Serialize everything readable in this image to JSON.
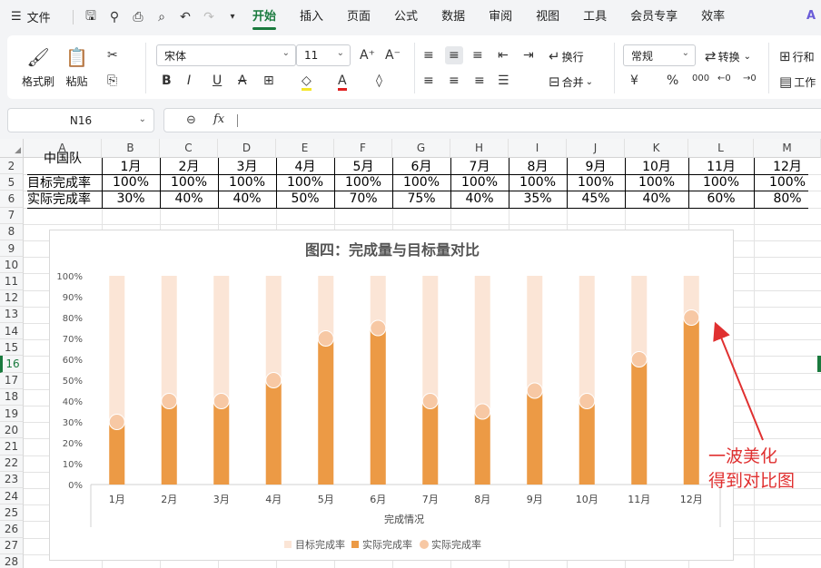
{
  "menubar": {
    "file_label": "文件",
    "tabs": [
      "开始",
      "插入",
      "页面",
      "公式",
      "数据",
      "审阅",
      "视图",
      "工具",
      "会员专享",
      "效率"
    ],
    "active_tab": "开始"
  },
  "ribbon": {
    "format_painter": "格式刷",
    "paste": "粘贴",
    "font_name": "宋体",
    "font_size": "11",
    "wrap": "换行",
    "merge": "合并",
    "number_format": "常规",
    "convert": "转换",
    "row_col": "行和",
    "worksheet": "工作"
  },
  "formula_bar": {
    "cell_ref": "N16",
    "fx_label": "fx",
    "formula": ""
  },
  "grid": {
    "columns": [
      "A",
      "B",
      "C",
      "D",
      "E",
      "F",
      "G",
      "H",
      "I",
      "J",
      "K",
      "L",
      "M"
    ],
    "rows": [
      "2",
      "5",
      "6",
      "7",
      "8",
      "9",
      "10",
      "11",
      "12",
      "13",
      "14",
      "15",
      "16",
      "17",
      "18",
      "19",
      "20",
      "21",
      "22",
      "23",
      "24",
      "25",
      "26",
      "27",
      "28"
    ],
    "selected_row": "16",
    "partial_header": "中国队",
    "header_row": [
      "1月",
      "2月",
      "3月",
      "4月",
      "5月",
      "6月",
      "7月",
      "8月",
      "9月",
      "10月",
      "11月",
      "12月"
    ],
    "target_label": "目标完成率",
    "target_row": [
      "100%",
      "100%",
      "100%",
      "100%",
      "100%",
      "100%",
      "100%",
      "100%",
      "100%",
      "100%",
      "100%",
      "100%"
    ],
    "actual_label": "实际完成率",
    "actual_row": [
      "30%",
      "40%",
      "40%",
      "50%",
      "70%",
      "75%",
      "40%",
      "35%",
      "45%",
      "40%",
      "60%",
      "80%"
    ]
  },
  "chart_data": {
    "type": "bar",
    "title": "图四：完成量与目标量对比",
    "xlabel": "完成情况",
    "ylabel": "",
    "categories": [
      "1月",
      "2月",
      "3月",
      "4月",
      "5月",
      "6月",
      "7月",
      "8月",
      "9月",
      "10月",
      "11月",
      "12月"
    ],
    "series": [
      {
        "name": "目标完成率",
        "values": [
          100,
          100,
          100,
          100,
          100,
          100,
          100,
          100,
          100,
          100,
          100,
          100
        ],
        "color": "#fbe5d6"
      },
      {
        "name": "实际完成率",
        "values": [
          30,
          40,
          40,
          50,
          70,
          75,
          40,
          35,
          45,
          40,
          60,
          80
        ],
        "color": "#ec9a45"
      },
      {
        "name": "实际完成率",
        "values": [
          30,
          40,
          40,
          50,
          70,
          75,
          40,
          35,
          45,
          40,
          60,
          80
        ],
        "color": "#f7c8a4",
        "marker": "circle"
      }
    ],
    "y_ticks": [
      "0%",
      "10%",
      "20%",
      "30%",
      "40%",
      "50%",
      "60%",
      "70%",
      "80%",
      "90%",
      "100%"
    ],
    "ylim": [
      0,
      100
    ],
    "grid": false,
    "legend": "bottom"
  },
  "annotation": {
    "line1": "一波美化",
    "line2": "得到对比图",
    "color": "#e03030"
  }
}
